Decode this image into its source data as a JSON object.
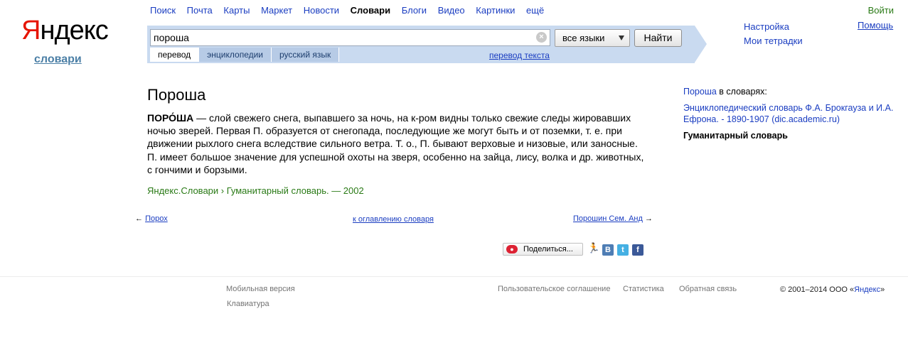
{
  "logo": {
    "ya": "Я",
    "rest": "ндекс",
    "sub": "словари"
  },
  "topnav": [
    "Поиск",
    "Почта",
    "Карты",
    "Маркет",
    "Новости",
    "Словари",
    "Блоги",
    "Видео",
    "Картинки",
    "ещё"
  ],
  "login": "Войти",
  "search": {
    "query": "пороша",
    "clear": "×",
    "lang": "все языки",
    "button": "Найти",
    "tabs": [
      "перевод",
      "энциклопедии",
      "русский язык"
    ],
    "translate_link": "перевод текста"
  },
  "right_links": {
    "settings": "Настройка",
    "notebooks": "Мои тетрадки",
    "help": "Помощь"
  },
  "article": {
    "title": "Пороша",
    "headword": "ПОРО́ША",
    "body": " — слой свежего снега, выпавшего за ночь, на к-ром видны только свежие следы жировавших ночью зверей. Первая П. образуется от снегопада, последующие же могут быть и от поземки, т. е. при движении рыхлого снега вследствие сильного ветра. Т. о., П. бывают верховые и низовые, или заносные. П. имеет большое значение для успешной охоты на зверя, особенно на зайца, лису, волка и др. животных, с гончими и борзыми.",
    "source": "Яндекс.Словари › Гуманитарный словарь. — 2002"
  },
  "pager": {
    "prev": "Порох",
    "index": "к оглавлению словаря",
    "next": "Порошин Сем. Анд",
    "prev_arrow": "←",
    "next_arrow": "→"
  },
  "share": {
    "label": "Поделиться...",
    "vk": "В",
    "tw": "t",
    "fb": "f"
  },
  "sidebar": {
    "word_link": "Пороша",
    "in_dicts": " в словарях:",
    "dict1": "Энциклопедический словарь Ф.А. Брокгауза и И.А. Ефрона. - 1890-1907 (dic.academic.ru)",
    "dict2": "Гуманитарный словарь"
  },
  "footer": {
    "mobile": "Мобильная версия",
    "keyboard": "Клавиатура",
    "agreement": "Пользовательское соглашение",
    "stats": "Статистика",
    "feedback": "Обратная связь",
    "copyright_pre": "© 2001–2014  ООО «",
    "company": "Яндекс",
    "copyright_post": "»"
  },
  "colors": {
    "search_bg": "#c9daf0",
    "brand_red": "#e61400",
    "link": "#1a3dc1",
    "green": "#2a7a16"
  }
}
